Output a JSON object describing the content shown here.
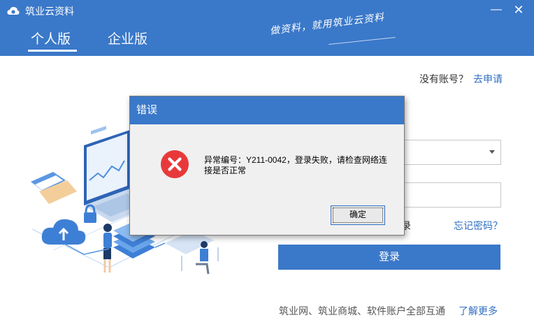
{
  "app": {
    "title": "筑业云资料",
    "slogan": "做资料，就用筑业云资料"
  },
  "window_controls": {
    "minimize": "—",
    "close": "✕"
  },
  "tabs": [
    {
      "label": "个人版",
      "active": true
    },
    {
      "label": "企业版",
      "active": false
    }
  ],
  "login": {
    "no_account_text": "没有账号？",
    "apply_link": "去申请",
    "auto_login_partial": "录",
    "forgot_password": "忘记密码？",
    "login_button": "登录",
    "footer_text": "筑业网、筑业商城、软件账户全部互通",
    "learn_more": "了解更多"
  },
  "dialog": {
    "title": "错误",
    "message": "异常编号：Y211-0042，登录失败，请检查网络连接是否正常",
    "ok_button": "确定",
    "icon": "error-icon"
  },
  "colors": {
    "brand_blue": "#3a78c9",
    "link_blue": "#2f6fc2",
    "error_red": "#e8393a"
  }
}
